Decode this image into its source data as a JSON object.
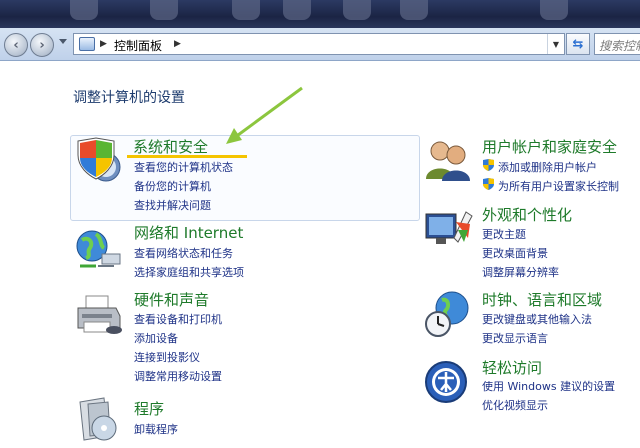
{
  "address_bar": {
    "breadcrumb": "控制面板",
    "search_placeholder": "搜索控制"
  },
  "heading": "调整计算机的设置",
  "left_categories": [
    {
      "title": "系统和安全",
      "icon": "security-shield-icon",
      "links": [
        "查看您的计算机状态",
        "备份您的计算机",
        "查找并解决问题"
      ]
    },
    {
      "title": "网络和 Internet",
      "icon": "network-globe-icon",
      "links": [
        "查看网络状态和任务",
        "选择家庭组和共享选项"
      ]
    },
    {
      "title": "硬件和声音",
      "icon": "printer-icon",
      "links": [
        "查看设备和打印机",
        "添加设备",
        "连接到投影仪",
        "调整常用移动设置"
      ]
    },
    {
      "title": "程序",
      "icon": "programs-icon",
      "links": [
        "卸载程序"
      ]
    }
  ],
  "right_categories": [
    {
      "title": "用户帐户和家庭安全",
      "icon": "users-icon",
      "links": [
        "添加或删除用户帐户",
        "为所有用户设置家长控制"
      ]
    },
    {
      "title": "外观和个性化",
      "icon": "appearance-icon",
      "links": [
        "更改主题",
        "更改桌面背景",
        "调整屏幕分辨率"
      ]
    },
    {
      "title": "时钟、语言和区域",
      "icon": "clock-globe-icon",
      "links": [
        "更改键盘或其他输入法",
        "更改显示语言"
      ]
    },
    {
      "title": "轻松访问",
      "icon": "ease-of-access-icon",
      "links": [
        "使用 Windows 建议的设置",
        "优化视频显示"
      ]
    }
  ],
  "colors": {
    "category_title": "#1e7a2a",
    "link": "#1e3287",
    "annotation_arrow": "#8cc63e",
    "annotation_underline": "#f5c400"
  }
}
